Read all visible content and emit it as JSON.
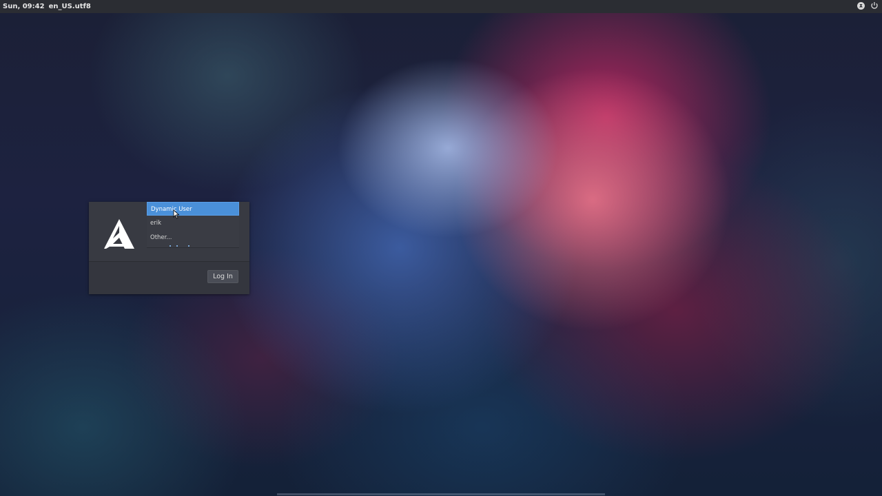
{
  "topbar": {
    "clock": "Sun, 09:42",
    "locale": "en_US.utf8",
    "icons": [
      "accessibility-icon",
      "power-icon"
    ]
  },
  "greeter": {
    "logo": "arch-logo-icon",
    "users": [
      {
        "label": "Dynamic User",
        "selected": true
      },
      {
        "label": "erik",
        "selected": false
      },
      {
        "label": "Other...",
        "selected": false
      }
    ],
    "login_label": "Log In"
  },
  "colors": {
    "selection": "#4a90d9",
    "panel": "#34363e",
    "topbar": "#2b2d33"
  }
}
